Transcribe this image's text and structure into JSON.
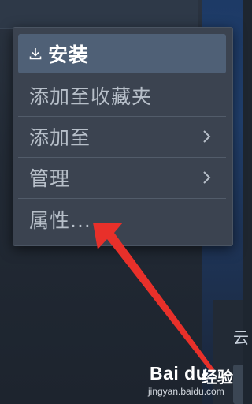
{
  "menu": {
    "items": [
      {
        "label": "安装",
        "icon": "download-icon",
        "highlighted": true
      },
      {
        "label": "添加至收藏夹"
      },
      {
        "label": "添加至",
        "submenu": true
      },
      {
        "label": "管理",
        "submenu": true
      },
      {
        "label": "属性..."
      }
    ]
  },
  "right_panel": {
    "partial_text": "云"
  },
  "annotation": {
    "color": "#e8302a"
  },
  "watermark": {
    "logo": "Bai du",
    "text": "经验",
    "url": "jingyan.baidu.com"
  }
}
